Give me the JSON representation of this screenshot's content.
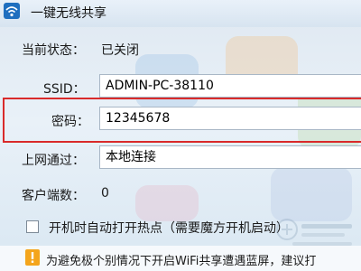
{
  "window": {
    "title": "一键无线共享",
    "app_icon": "wifi-share-icon"
  },
  "status": {
    "label": "当前状态：",
    "value": "已关闭"
  },
  "ssid": {
    "label": "SSID：",
    "value": "ADMIN-PC-38110"
  },
  "password": {
    "label": "密码：",
    "value": "12345678",
    "highlight_color": "#d92a2a"
  },
  "connection": {
    "label": "上网通过：",
    "value": "本地连接"
  },
  "clients": {
    "label": "客户端数：",
    "value": "0"
  },
  "autostart": {
    "label": "开机时自动打开热点（需要魔方开机启动）",
    "checked": false
  },
  "notice": {
    "icon": "warning-icon",
    "text": "为避免极个别情况下开启WiFi共享遭遇蓝屏，建议打"
  },
  "watermark": {
    "icon": "pconline-watermark-logo"
  }
}
